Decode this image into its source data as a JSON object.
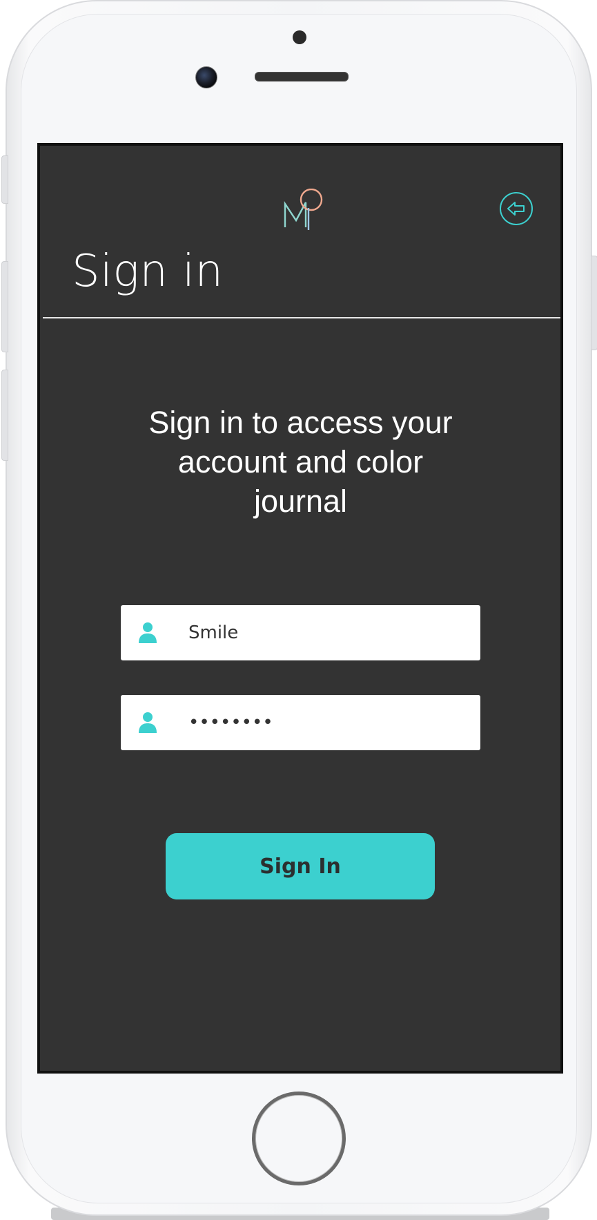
{
  "header": {
    "logo_icon": "mq-logo-icon",
    "back_icon": "arrow-left-circle-icon"
  },
  "page": {
    "title": "Sign in",
    "intro": "Sign in to access your account and color journal"
  },
  "form": {
    "username_value": "Smile",
    "password_value": "••••••••",
    "field_icon": "user-icon",
    "submit_label": "Sign In"
  },
  "colors": {
    "accent": "#3cd0cf",
    "screen_bg": "#333333",
    "text": "#ffffff"
  }
}
